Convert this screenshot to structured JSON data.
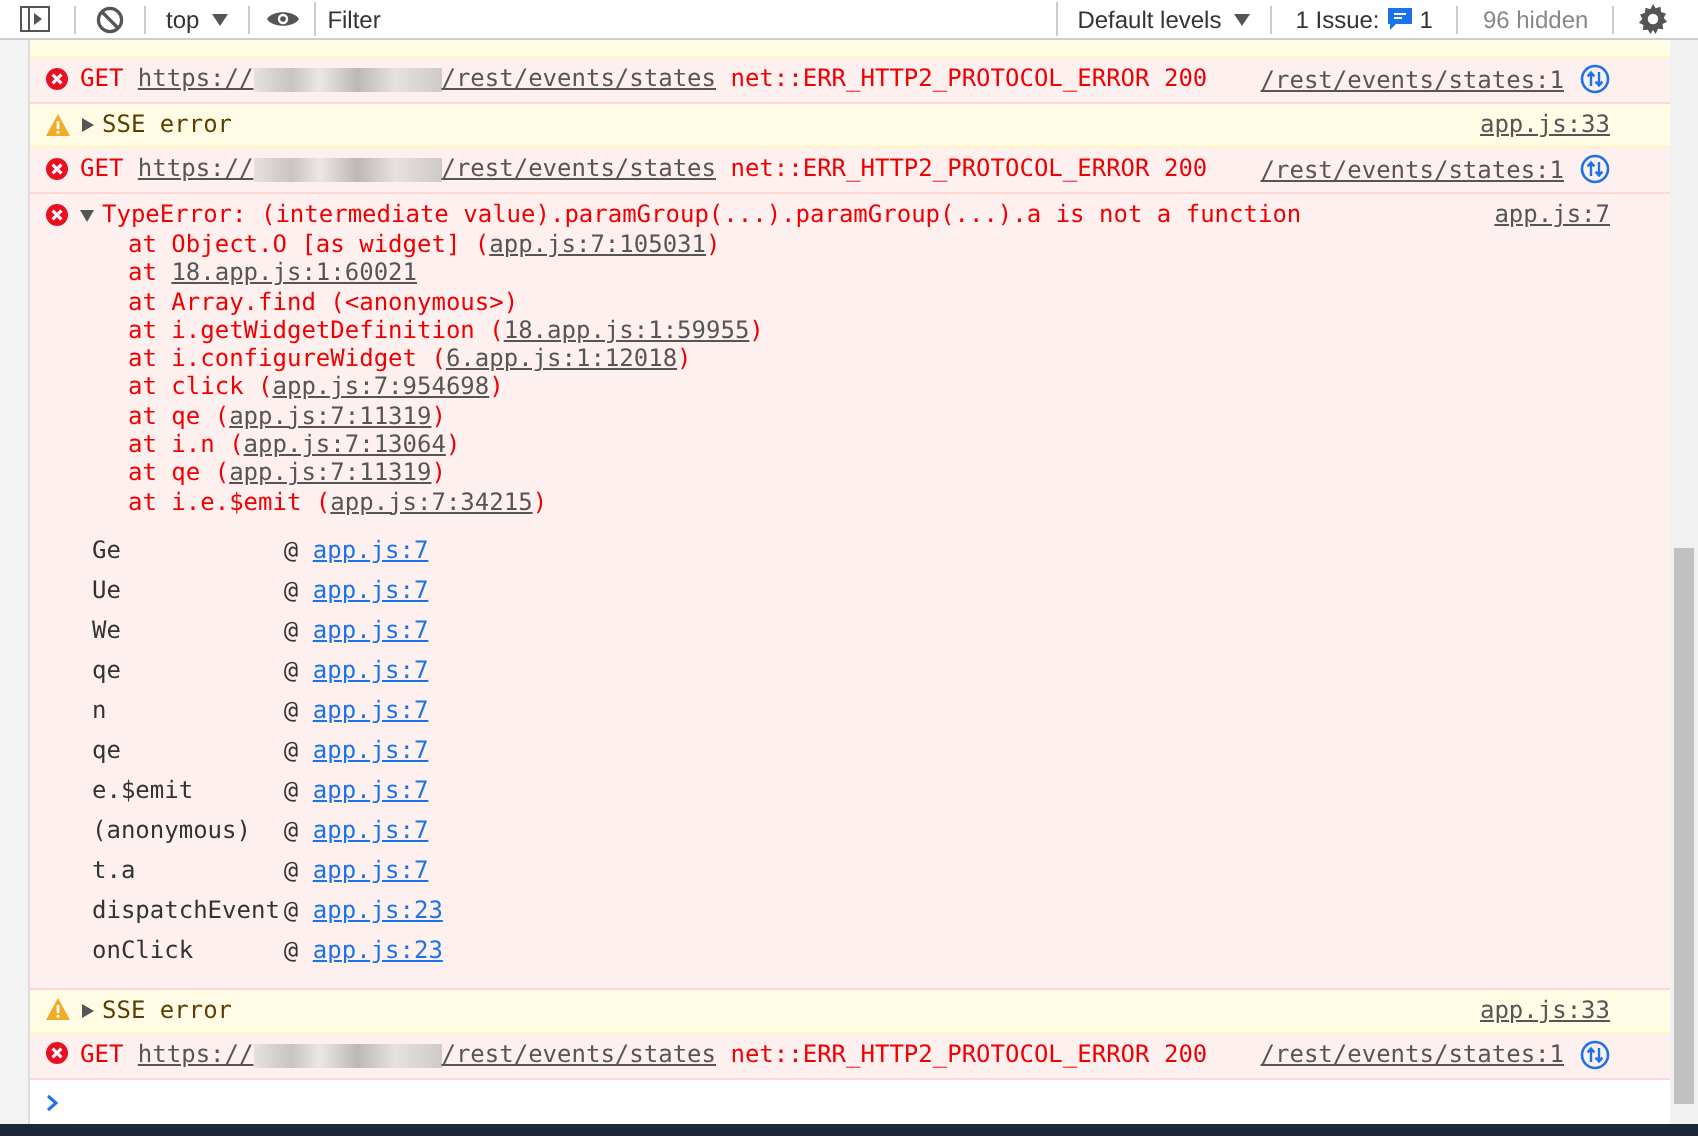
{
  "toolbar": {
    "context": "top",
    "filter": {
      "placeholder": "Filter"
    },
    "levels": "Default levels",
    "issues": {
      "label": "1 Issue:",
      "count": "1"
    },
    "hidden": "96 hidden"
  },
  "messages": [
    {
      "kind": "clipped-warning"
    },
    {
      "kind": "network-error",
      "method": "GET",
      "url_start": "https://",
      "url_end": "/rest/events/states",
      "status": "net::ERR_HTTP2_PROTOCOL_ERROR 200",
      "source": "/rest/events/states:1"
    },
    {
      "kind": "warning",
      "expanded": false,
      "text": "SSE error",
      "source": "app.js:33"
    },
    {
      "kind": "network-error",
      "method": "GET",
      "url_start": "https://",
      "url_end": "/rest/events/states",
      "status": "net::ERR_HTTP2_PROTOCOL_ERROR 200",
      "source": "/rest/events/states:1"
    },
    {
      "kind": "exception",
      "expanded": true,
      "text": "TypeError: (intermediate value).paramGroup(...).paramGroup(...).a is not a function",
      "source": "app.js:7",
      "stack": [
        {
          "prefix": "at Object.O [as widget] (",
          "link": "app.js:7:105031",
          "suffix": ")"
        },
        {
          "prefix": "at ",
          "link": "18.app.js:1:60021"
        },
        {
          "prefix": "at Array.find (<anonymous>)"
        },
        {
          "prefix": "at i.getWidgetDefinition (",
          "link": "18.app.js:1:59955",
          "suffix": ")"
        },
        {
          "prefix": "at i.configureWidget (",
          "link": "6.app.js:1:12018",
          "suffix": ")"
        },
        {
          "prefix": "at click (",
          "link": "app.js:7:954698",
          "suffix": ")"
        },
        {
          "prefix": "at qe (",
          "link": "app.js:7:11319",
          "suffix": ")"
        },
        {
          "prefix": "at i.n (",
          "link": "app.js:7:13064",
          "suffix": ")"
        },
        {
          "prefix": "at qe (",
          "link": "app.js:7:11319",
          "suffix": ")"
        },
        {
          "prefix": "at i.e.$emit (",
          "link": "app.js:7:34215",
          "suffix": ")"
        }
      ],
      "frames": [
        {
          "name": "Ge",
          "marker": "@",
          "link": "app.js:7"
        },
        {
          "name": "Ue",
          "marker": "@",
          "link": "app.js:7"
        },
        {
          "name": "We",
          "marker": "@",
          "link": "app.js:7"
        },
        {
          "name": "qe",
          "marker": "@",
          "link": "app.js:7"
        },
        {
          "name": "n",
          "marker": "@",
          "link": "app.js:7"
        },
        {
          "name": "qe",
          "marker": "@",
          "link": "app.js:7"
        },
        {
          "name": "e.$emit",
          "marker": "@",
          "link": "app.js:7"
        },
        {
          "name": "(anonymous)",
          "marker": "@",
          "link": "app.js:7"
        },
        {
          "name": "t.a",
          "marker": "@",
          "link": "app.js:7"
        },
        {
          "name": "dispatchEvent",
          "marker": "@",
          "link": "app.js:23"
        },
        {
          "name": "onClick",
          "marker": "@",
          "link": "app.js:23"
        }
      ]
    },
    {
      "kind": "warning",
      "expanded": false,
      "text": "SSE error",
      "source": "app.js:33"
    },
    {
      "kind": "network-error",
      "method": "GET",
      "url_start": "https://",
      "url_end": "/rest/events/states",
      "status": "net::ERR_HTTP2_PROTOCOL_ERROR 200",
      "source": "/rest/events/states:1"
    }
  ]
}
